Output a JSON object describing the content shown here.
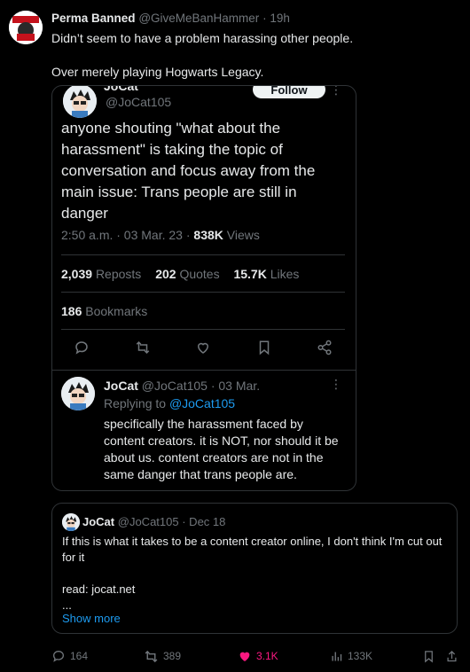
{
  "tweet": {
    "author_name": "Perma Banned",
    "author_handle": "@GiveMeBanHammer",
    "time": "19h",
    "text_line1": "Didn’t seem to have a problem harassing other people.",
    "text_line2": "Over merely playing Hogwarts Legacy."
  },
  "screenshot": {
    "author_name_clipped": "JoCat",
    "author_handle": "@JoCat105",
    "follow_label": "Follow",
    "body": "anyone shouting \"what about the harassment\" is taking the topic of conversation and focus away from the main issue: Trans people are still in danger",
    "time_date": "2:50 a.m. · 03 Mar. 23 · ",
    "views_count": "838K",
    "views_label": " Views",
    "reposts_count": "2,039",
    "reposts_label": "Reposts",
    "quotes_count": "202",
    "quotes_label": "Quotes",
    "likes_count": "15.7K",
    "likes_label": "Likes",
    "bookmarks_count": "186",
    "bookmarks_label": "Bookmarks",
    "reply": {
      "author_name": "JoCat",
      "author_handle": "@JoCat105",
      "date": "· 03 Mar.",
      "replying_to_prefix": "Replying to ",
      "replying_to_handle": "@JoCat105",
      "text": "specifically the harassment faced by content creators. it is NOT, nor should it be about us. content creators are not in the same danger that trans people are."
    }
  },
  "quote": {
    "author_name": "JoCat",
    "author_handle": "@JoCat105",
    "date": "· Dec 18",
    "text_line1": "If this is what it takes to be a content creator online, I don't think I'm cut out for it",
    "text_line2": "read: jocat.net",
    "text_line3": "...",
    "show_more": "Show more"
  },
  "actions": {
    "replies": "164",
    "reposts": "389",
    "likes": "3.1K",
    "views": "133K"
  },
  "colors": {
    "background": "#000000",
    "text": "#e7e9ea",
    "muted": "#71767b",
    "link": "#1d9bf0",
    "like": "#f91880",
    "border": "#2f3336"
  }
}
